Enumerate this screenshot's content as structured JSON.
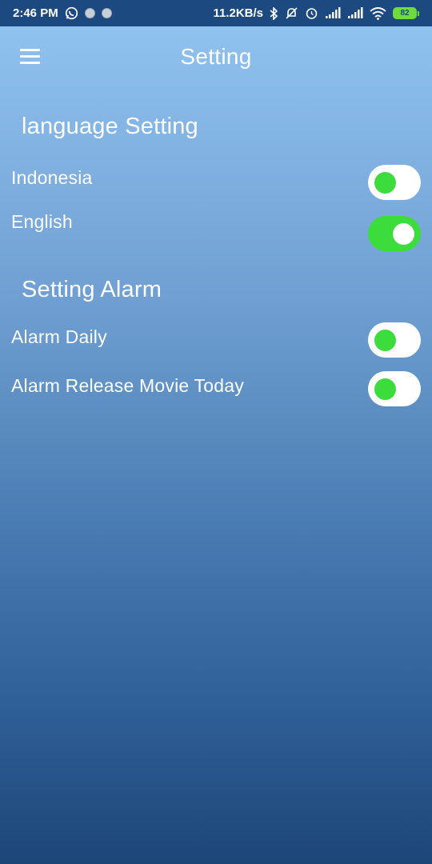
{
  "status_bar": {
    "time": "2:46 PM",
    "network_speed": "11.2KB/s",
    "battery_level": "82",
    "icons": [
      "whatsapp-icon",
      "notification-dot-icon",
      "notification-dot-icon",
      "bluetooth-icon",
      "mute-icon",
      "alarm-icon",
      "signal-icon",
      "signal-icon",
      "wifi-icon",
      "battery-icon"
    ]
  },
  "app_bar": {
    "title": "Setting",
    "menu_icon": "hamburger-menu-icon"
  },
  "language_section": {
    "header": "language Setting",
    "items": [
      {
        "label": "Indonesia",
        "enabled": false
      },
      {
        "label": "English",
        "enabled": true
      }
    ]
  },
  "alarm_section": {
    "header": "Setting Alarm",
    "items": [
      {
        "label": "Alarm Daily",
        "enabled": false
      },
      {
        "label": "Alarm Release Movie Today",
        "enabled": false
      }
    ]
  },
  "colors": {
    "status_bar": "#1c4a80",
    "gradient_top": "#93c5f2",
    "gradient_bottom": "#1d4678",
    "switch_accent": "#3ddc3d",
    "battery": "#6fdc3c"
  }
}
